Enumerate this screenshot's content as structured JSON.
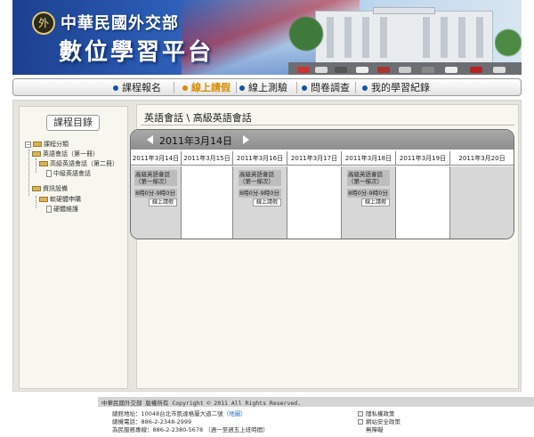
{
  "banner": {
    "emblem_text": "外",
    "ministry_name": "中華民國外交部",
    "platform_name": "數位學習平台"
  },
  "nav": {
    "items": [
      {
        "label": "課程報名",
        "active": false
      },
      {
        "label": "線上請假",
        "active": true
      },
      {
        "label": "線上測驗",
        "active": false
      },
      {
        "label": "問卷調查",
        "active": false
      },
      {
        "label": "我的學習紀錄",
        "active": false
      }
    ]
  },
  "sidebar": {
    "title": "課程目錄",
    "tree": [
      {
        "label": "課程分類",
        "level": 0
      },
      {
        "label": "英語會話（第一冊）",
        "level": 1
      },
      {
        "label": "高級英語會話（第二冊）",
        "level": 2
      },
      {
        "label": "中級英語會話",
        "level": 3
      },
      {
        "label": "資訊設備",
        "level": 1
      },
      {
        "label": "軟硬體申購",
        "level": 2
      },
      {
        "label": "硬體維護",
        "level": 3
      }
    ]
  },
  "breadcrumb": "英語會話 \\ 高級英語會話",
  "calendar": {
    "title": "2011年3月14日",
    "days": [
      {
        "date": "2011年3月14日",
        "gray": true,
        "course": true
      },
      {
        "date": "2011年3月15日",
        "gray": false,
        "course": false
      },
      {
        "date": "2011年3月16日",
        "gray": true,
        "course": true
      },
      {
        "date": "2011年3月17日",
        "gray": false,
        "course": false
      },
      {
        "date": "2011年3月18日",
        "gray": true,
        "course": true
      },
      {
        "date": "2011年3月19日",
        "gray": false,
        "course": false
      },
      {
        "date": "2011年3月20日",
        "gray": true,
        "course": false
      }
    ],
    "course": {
      "title": "高級英語會話（第一梯次）",
      "time": "8時0分-9時0分",
      "leave_button": "線上請假"
    }
  },
  "footer": {
    "copyright": "中華民國外交部 版權所有 Copyright © 2011 All Rights Reserved.",
    "address": "總館地址：10048台北市凱達格蘭大道二號",
    "map_link": "（地圖）",
    "phone": "總機電話：886-2-2348-2999",
    "service_line": "為民服務專線：886-2-2380-5678 （週一至週五上班時間）",
    "links": [
      "隱私權政策",
      "網站安全政策",
      "無障礙"
    ]
  }
}
